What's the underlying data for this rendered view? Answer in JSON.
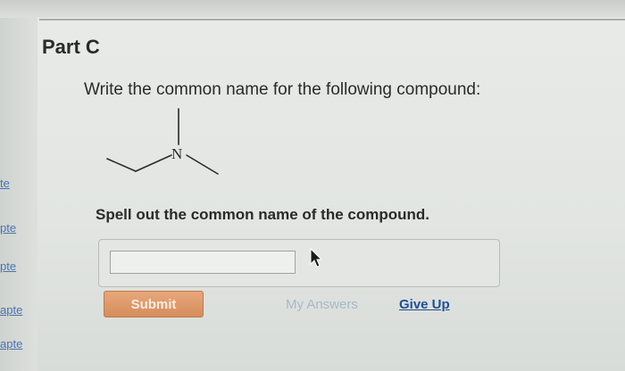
{
  "sidebar": {
    "items": [
      {
        "label": "te"
      },
      {
        "label": "pte"
      },
      {
        "label": "pte"
      },
      {
        "label": "apte"
      },
      {
        "label": "apte"
      }
    ]
  },
  "part": {
    "title": "Part C",
    "question": "Write the common name for the following compound:"
  },
  "structure": {
    "atom_label": "N"
  },
  "answer": {
    "instruction": "Spell out the common name of the compound.",
    "input_value": ""
  },
  "actions": {
    "submit_label": "Submit",
    "my_answers_label": "My Answers",
    "give_up_label": "Give Up"
  },
  "colors": {
    "submit": "#d58d5c",
    "link": "#1f4f96",
    "link_disabled": "#a8b8c8"
  }
}
